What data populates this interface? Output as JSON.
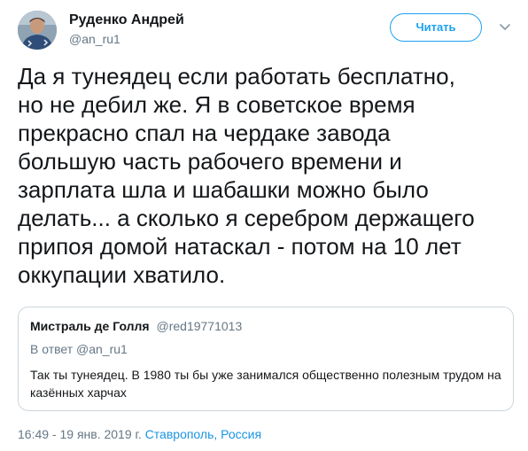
{
  "author": {
    "name": "Руденко Андрей",
    "handle": "@an_ru1"
  },
  "actions": {
    "follow_label": "Читать",
    "caret_icon": "chevron-down-icon"
  },
  "tweet": {
    "lines": [
      "Да я тунеядец если работать бесплатно,",
      "но не дебил же. Я в советское время",
      "прекрасно спал на чердаке завода",
      "большую часть рабочего времени и",
      "зарплата шла и шабашки можно было",
      "делать... а сколько я серебром держащего",
      "припоя домой натаскал - потом на 10 лет",
      "оккупации хватило."
    ]
  },
  "quote": {
    "name": "Мистраль де Голля",
    "handle": "@red19771013",
    "reply_to": "В ответ @an_ru1",
    "lines": [
      "Так ты тунеядец. В 1980 ты бы уже занимался общественно полезным трудом на",
      "казённых харчах"
    ]
  },
  "meta": {
    "timestamp": "16:49 - 19 янв. 2019 г.",
    "location": "Ставрополь, Россия"
  },
  "colors": {
    "accent": "#1da1f2",
    "link": "#1b95e0",
    "text": "#14171a",
    "secondary": "#657786",
    "border": "#ccd6dd"
  }
}
